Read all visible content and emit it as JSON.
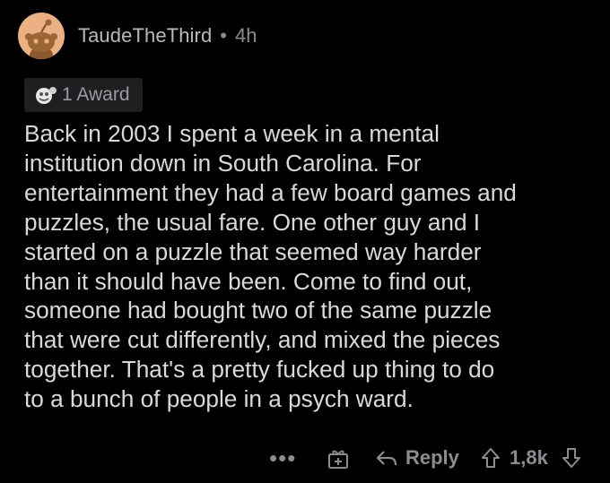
{
  "comment": {
    "author": "TaudeTheThird",
    "separator": "•",
    "time": "4h",
    "award_label": "1 Award",
    "body_lines": [
      "Back in 2003 I spent a week in a mental",
      "institution down in South Carolina. For",
      "entertainment they had a few board games and",
      "puzzles, the usual fare. One other guy and I",
      "started on a puzzle that seemed way harder",
      "than it should have been.  Come to find out,",
      "someone had bought two of the same puzzle",
      "that were cut differently, and mixed the pieces",
      "together. That's a pretty fucked up thing to do",
      "to a bunch of people in a psych ward."
    ]
  },
  "actions": {
    "more_label": "•••",
    "reply_label": "Reply",
    "score": "1,8k"
  },
  "icons": {
    "avatar": "reddit-snoo-avatar",
    "award": "award-icon",
    "gift": "gift-icon",
    "reply": "reply-arrow-icon",
    "upvote": "upvote-arrow-icon",
    "downvote": "downvote-arrow-icon"
  },
  "colors": {
    "background": "#000000",
    "text": "#d7dadc",
    "meta": "#8a8d90",
    "avatar_bg": "#ebb184"
  }
}
